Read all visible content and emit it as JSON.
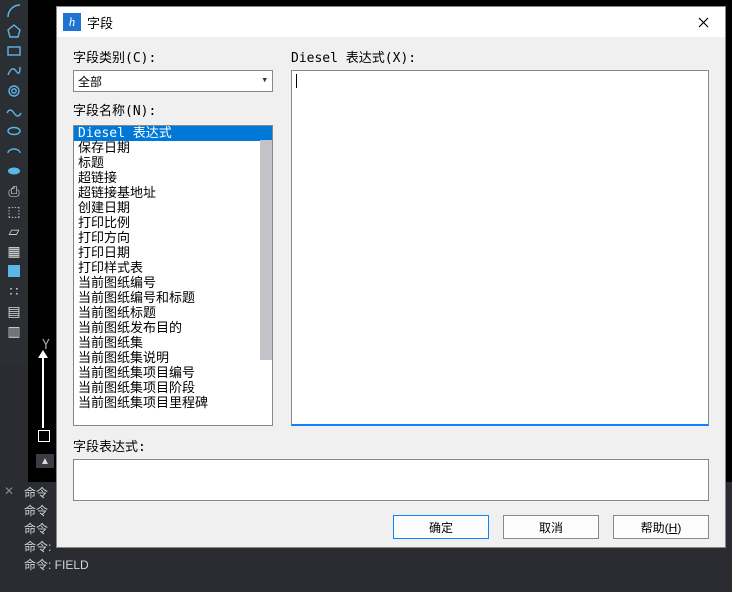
{
  "dialog": {
    "title": "字段",
    "labels": {
      "category": "字段类别(C):",
      "name": "字段名称(N):",
      "expression_title": "Diesel 表达式(X):",
      "field_expression": "字段表达式:"
    },
    "category_value": "全部",
    "names": [
      "Diesel 表达式",
      "保存日期",
      "标题",
      "超链接",
      "超链接基地址",
      "创建日期",
      "打印比例",
      "打印方向",
      "打印日期",
      "打印样式表",
      "当前图纸编号",
      "当前图纸编号和标题",
      "当前图纸标题",
      "当前图纸发布目的",
      "当前图纸集",
      "当前图纸集说明",
      "当前图纸集项目编号",
      "当前图纸集项目阶段",
      "当前图纸集项目里程碑"
    ],
    "selected_index": 0,
    "expression_value": "",
    "field_expression_value": "",
    "buttons": {
      "ok": "确定",
      "cancel": "取消",
      "help_pre": "帮助(",
      "help_u": "H",
      "help_post": ")"
    }
  },
  "command": {
    "lines": [
      "命令",
      "命令",
      "命令",
      "命令:",
      "命令:  FIELD"
    ]
  },
  "ucs": {
    "y_label": "Y"
  }
}
